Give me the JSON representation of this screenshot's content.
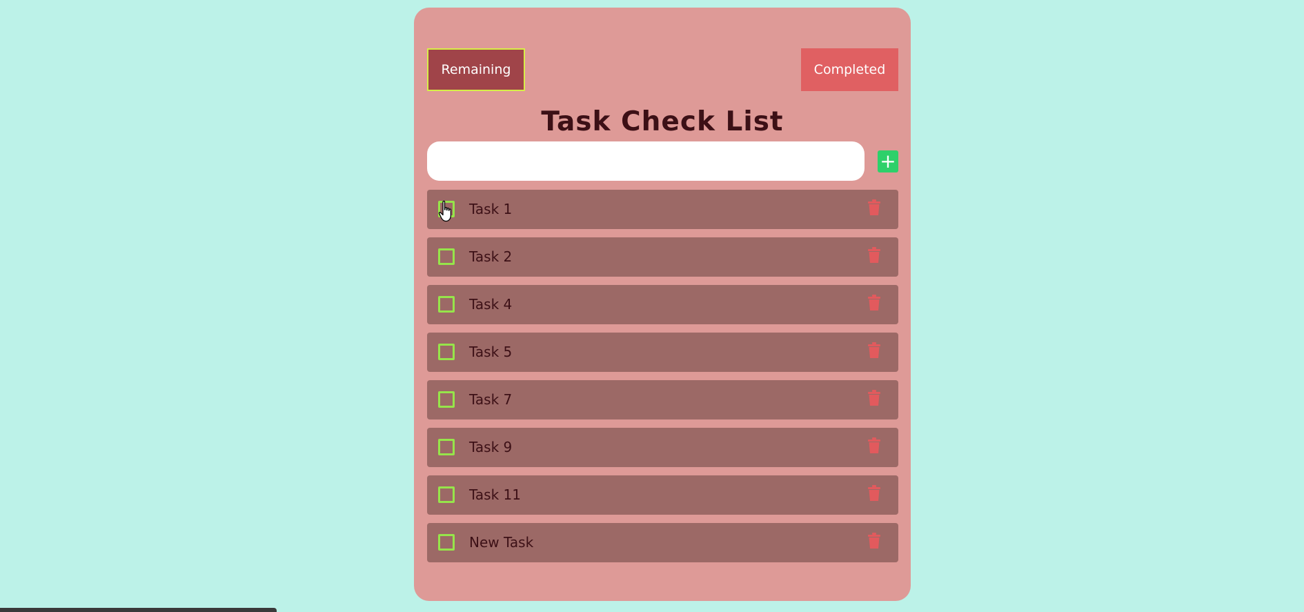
{
  "filters": {
    "remaining_label": "Remaining",
    "completed_label": "Completed",
    "active": "remaining"
  },
  "header": {
    "title": "Task Check List"
  },
  "input": {
    "value": "",
    "placeholder": ""
  },
  "add_button": {
    "icon": "plus-icon"
  },
  "tasks": [
    {
      "label": "Task 1",
      "checked": false
    },
    {
      "label": "Task 2",
      "checked": false
    },
    {
      "label": "Task 4",
      "checked": false
    },
    {
      "label": "Task 5",
      "checked": false
    },
    {
      "label": "Task 7",
      "checked": false
    },
    {
      "label": "Task 9",
      "checked": false
    },
    {
      "label": "Task 11",
      "checked": false
    },
    {
      "label": "New Task",
      "checked": false
    }
  ],
  "colors": {
    "background": "#bcf2e8",
    "card": "#de9a97",
    "task_row": "#9c6966",
    "remaining_button": "#a04449",
    "completed_button": "#e06062",
    "add_button": "#2ed06a",
    "checkbox_border": "#96e54a",
    "trash_icon": "#e25a5d",
    "text_dark": "#3c1016"
  }
}
